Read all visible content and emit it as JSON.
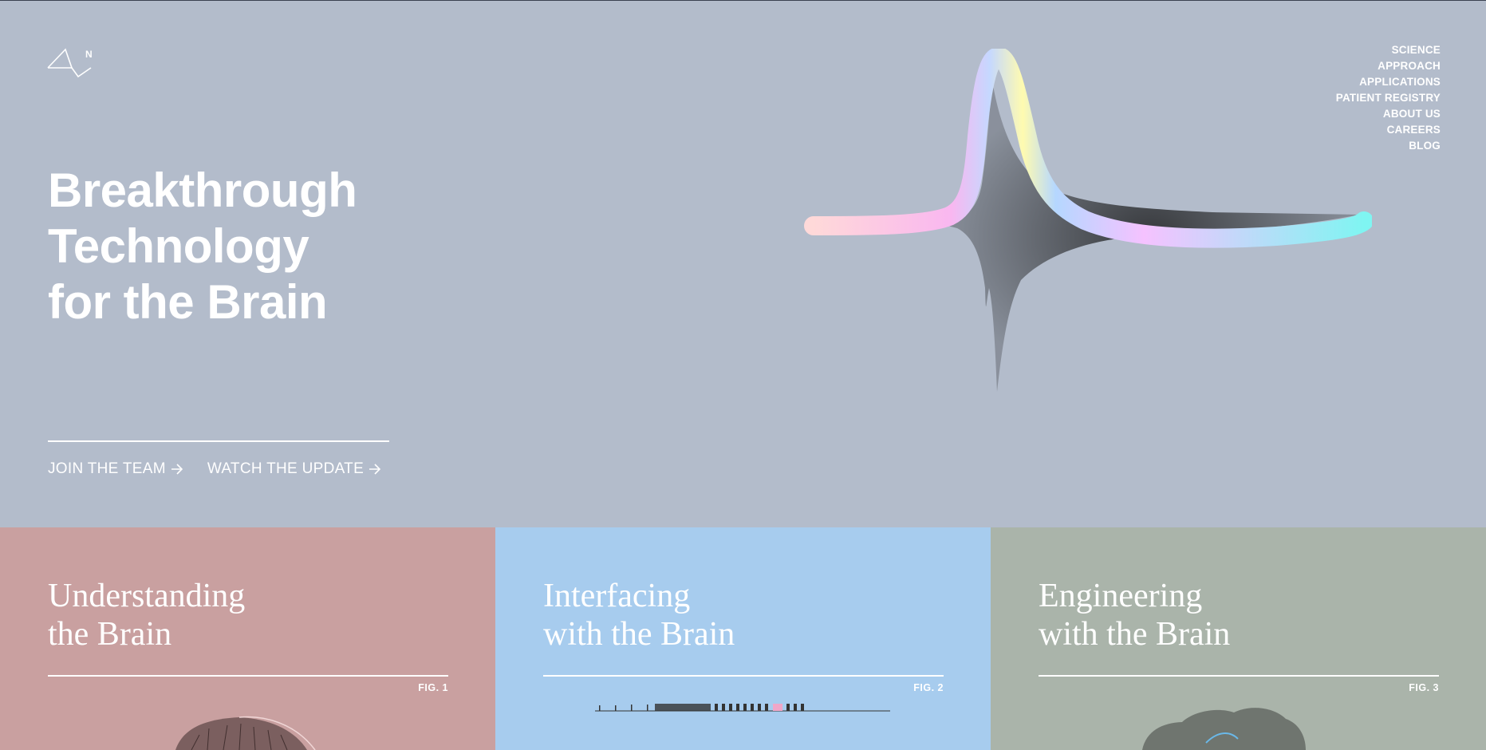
{
  "brand": {
    "logo_letter": "N"
  },
  "nav": {
    "items": [
      {
        "label": "SCIENCE"
      },
      {
        "label": "APPROACH"
      },
      {
        "label": "APPLICATIONS"
      },
      {
        "label": "PATIENT REGISTRY"
      },
      {
        "label": "ABOUT US"
      },
      {
        "label": "CAREERS"
      },
      {
        "label": "BLOG"
      }
    ]
  },
  "hero": {
    "headline": [
      "Breakthrough",
      "Technology",
      "for the Brain"
    ],
    "ctas": [
      {
        "label": "JOIN THE TEAM",
        "icon": "arrow-right-icon"
      },
      {
        "label": "WATCH THE UPDATE",
        "icon": "arrow-right-icon"
      }
    ]
  },
  "panels": [
    {
      "title_lines": [
        "Understanding",
        "the Brain"
      ],
      "fig": "FIG. 1",
      "color": "#c9a0a0"
    },
    {
      "title_lines": [
        "Interfacing",
        "with the Brain"
      ],
      "fig": "FIG. 2",
      "color": "#a7ccee"
    },
    {
      "title_lines": [
        "Engineering",
        "with the Brain"
      ],
      "fig": "FIG. 3",
      "color": "#aab4aa"
    }
  ],
  "colors": {
    "hero_bg": "#b3bccb",
    "text": "#ffffff"
  }
}
